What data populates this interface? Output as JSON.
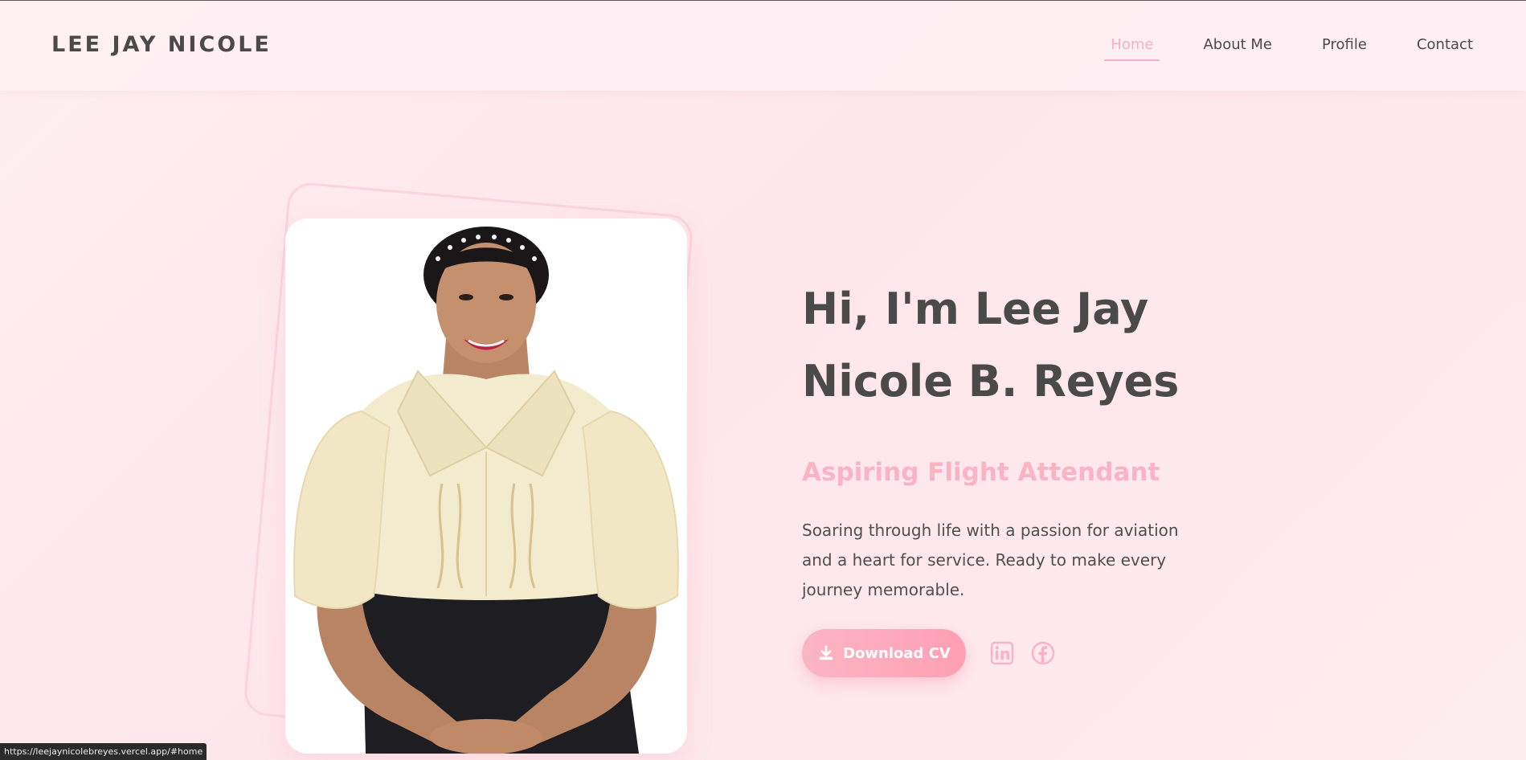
{
  "brand": {
    "name": "LEE JAY NICOLE"
  },
  "nav": {
    "items": [
      {
        "label": "Home",
        "active": true
      },
      {
        "label": "About Me",
        "active": false
      },
      {
        "label": "Profile",
        "active": false
      },
      {
        "label": "Contact",
        "active": false
      }
    ]
  },
  "hero": {
    "title_line1": "Hi, I'm Lee Jay",
    "title_line2": "Nicole B. Reyes",
    "subtitle": "Aspiring Flight Attendant",
    "description": "Soaring through life with a passion for aviation and a heart for service. Ready to make every journey memorable.",
    "cv_button_label": "Download CV",
    "cv_button_icon": "download-icon",
    "social_icons": [
      "linkedin-icon",
      "facebook-icon"
    ]
  },
  "status_url": "https://leejaynicolebreyes.vercel.app/#home",
  "colors": {
    "accent_pink": "#f9b3c3",
    "button_pink": "#ff9fb4",
    "text_dark": "#4a4a4a",
    "background": "#ffe6ec"
  }
}
